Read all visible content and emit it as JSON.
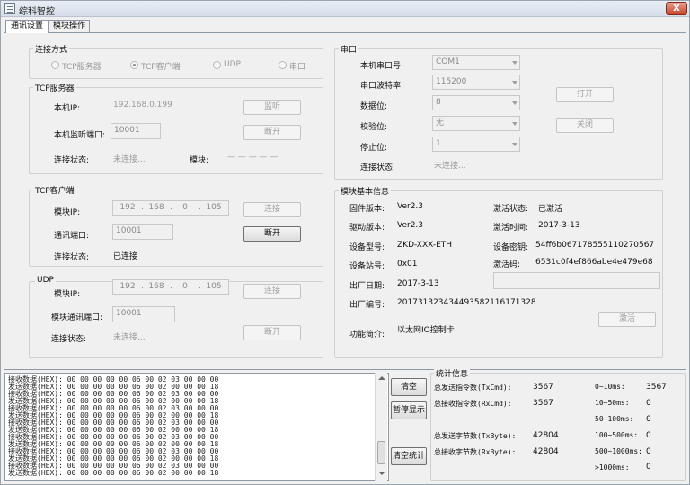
{
  "window": {
    "title": "综科智控",
    "close_label": "X"
  },
  "tabs": [
    {
      "label": "通讯设置"
    },
    {
      "label": "模块操作"
    }
  ],
  "connection": {
    "title": "连接方式",
    "options": [
      {
        "label": "TCP服务器",
        "selected": false
      },
      {
        "label": "TCP客户端",
        "selected": true
      },
      {
        "label": "UDP",
        "selected": false
      },
      {
        "label": "串口",
        "selected": false
      }
    ]
  },
  "tcp_server": {
    "title": "TCP服务器",
    "ip_label": "本机IP:",
    "ip_value": "192.168.0.199",
    "port_label": "本机监听端口:",
    "port_value": "10001",
    "status_label": "连接状态:",
    "status_value": "未连接...",
    "module_label": "模块:",
    "module_value": "— — — — —",
    "listen_button": "监听",
    "disconnect_button": "断开"
  },
  "tcp_client": {
    "title": "TCP客户端",
    "ip_label": "模块IP:",
    "ip": [
      "192",
      "168",
      "0",
      "105"
    ],
    "port_label": "通讯端口:",
    "port_value": "10001",
    "status_label": "连接状态:",
    "status_value": "已连接",
    "connect_button": "连接",
    "disconnect_button": "断开"
  },
  "udp": {
    "title": "UDP",
    "ip_label": "模块IP:",
    "ip": [
      "192",
      "168",
      "0",
      "105"
    ],
    "port_label": "模块通讯端口:",
    "port_value": "10001",
    "status_label": "连接状态:",
    "status_value": "未连接...",
    "connect_button": "连接",
    "disconnect_button": "断开"
  },
  "serial": {
    "title": "串口",
    "port_label": "本机串口号:",
    "port_value": "COM1",
    "baud_label": "串口波特率:",
    "baud_value": "115200",
    "databits_label": "数据位:",
    "databits_value": "8",
    "parity_label": "校验位:",
    "parity_value": "无",
    "stopbits_label": "停止位:",
    "stopbits_value": "1",
    "status_label": "连接状态:",
    "status_value": "未连接...",
    "open_button": "打开",
    "close_button": "关闭"
  },
  "module_info": {
    "title": "模块基本信息",
    "firmware_label": "固件版本:",
    "firmware_value": "Ver2.3",
    "driver_label": "驱动版本:",
    "driver_value": "Ver2.3",
    "model_label": "设备型号:",
    "model_value": "ZKD-XXX-ETH",
    "station_label": "设备站号:",
    "station_value": "0x01",
    "date_label": "出厂日期:",
    "date_value": "2017-3-13",
    "serial_label": "出厂编号:",
    "serial_value": "20173132343449358211617132­8",
    "desc_label": "功能简介:",
    "desc_value": "以太网IO控制卡",
    "act_status_label": "激活状态:",
    "act_status_value": "已激活",
    "act_time_label": "激活时间:",
    "act_time_value": "2017-3-13",
    "key_label": "设备密钥:",
    "key_value": "54ff6b067178555110270567",
    "act_code_label": "激活码:",
    "act_code_value": "6531c0f4ef866abe4e479e68",
    "activate_button": "激活"
  },
  "log": {
    "lines": [
      "接收数据(HEX): 00 00 00 00 00 06 00 02 03 00 00 00",
      "发送数据(HEX): 00 00 00 00 00 06 00 02 00 00 00 18",
      "接收数据(HEX): 00 00 00 00 00 06 00 02 03 00 00 00",
      "发送数据(HEX): 00 00 00 00 00 06 00 02 00 00 00 18",
      "接收数据(HEX): 00 00 00 00 00 06 00 02 03 00 00 00",
      "发送数据(HEX): 00 00 00 00 00 06 00 02 00 00 00 18",
      "接收数据(HEX): 00 00 00 00 00 06 00 02 03 00 00 00",
      "发送数据(HEX): 00 00 00 00 00 06 00 02 00 00 00 18",
      "接收数据(HEX): 00 00 00 00 00 06 00 02 03 00 00 00",
      "发送数据(HEX): 00 00 00 00 00 06 00 02 00 00 00 18",
      "接收数据(HEX): 00 00 00 00 00 06 00 02 03 00 00 00",
      "发送数据(HEX): 00 00 00 00 00 06 00 02 00 00 00 18",
      "接收数据(HEX): 00 00 00 00 00 06 00 02 03 00 00 00",
      "发送数据(HEX): 00 00 00 00 00 06 00 02 00 00 00 18",
      "接收数据(HEX): 00 00 00 00 00 06 00 02 03 00 00 00"
    ],
    "clear_button": "清空",
    "pause_button": "暂停显示",
    "clear_stats_button": "清空统计"
  },
  "stats": {
    "title": "统计信息",
    "tx_cmd_label": "总发送指令数(TxCmd):",
    "tx_cmd_value": "3567",
    "rx_cmd_label": "总接收指令数(RxCmd):",
    "rx_cmd_value": "3567",
    "tx_byte_label": "总发送字节数(TxByte):",
    "tx_byte_value": "42804",
    "rx_byte_label": "总接收字节数(RxByte):",
    "rx_byte_value": "42804",
    "r1_label": "0~10ms:",
    "r1_value": "3567",
    "r2_label": "10~50ms:",
    "r2_value": "0",
    "r3_label": "50~100ms:",
    "r3_value": "0",
    "r4_label": "100~500ms:",
    "r4_value": "0",
    "r5_label": "500~1000ms:",
    "r5_value": "0",
    "r6_label": ">1000ms:",
    "r6_value": "0"
  }
}
